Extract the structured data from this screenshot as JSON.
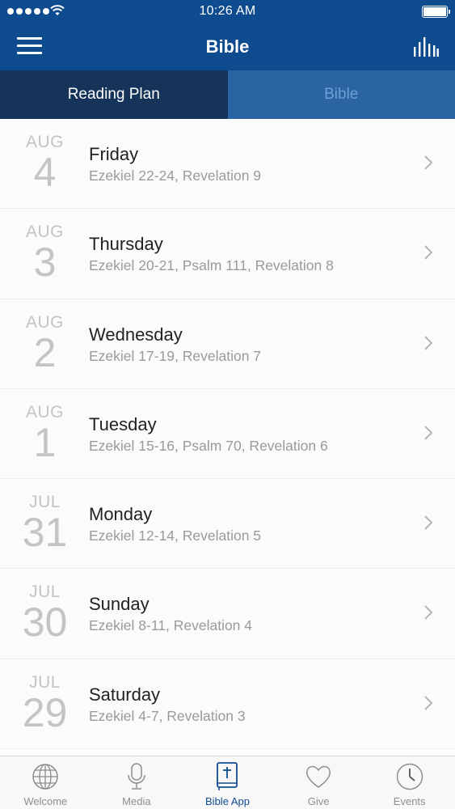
{
  "status_bar": {
    "time": "10:26 AM"
  },
  "nav": {
    "title": "Bible",
    "left_icon": "menu-icon",
    "right_icon": "audio-bars-icon"
  },
  "tabs": [
    {
      "label": "Reading Plan",
      "active": true
    },
    {
      "label": "Bible",
      "active": false
    }
  ],
  "readings": [
    {
      "month": "AUG",
      "day": "4",
      "weekday": "Friday",
      "passages": "Ezekiel 22-24, Revelation 9"
    },
    {
      "month": "AUG",
      "day": "3",
      "weekday": "Thursday",
      "passages": "Ezekiel 20-21, Psalm 111, Revelation 8"
    },
    {
      "month": "AUG",
      "day": "2",
      "weekday": "Wednesday",
      "passages": "Ezekiel 17-19, Revelation 7"
    },
    {
      "month": "AUG",
      "day": "1",
      "weekday": "Tuesday",
      "passages": "Ezekiel 15-16, Psalm 70, Revelation 6"
    },
    {
      "month": "JUL",
      "day": "31",
      "weekday": "Monday",
      "passages": "Ezekiel 12-14, Revelation 5"
    },
    {
      "month": "JUL",
      "day": "30",
      "weekday": "Sunday",
      "passages": "Ezekiel 8-11, Revelation 4"
    },
    {
      "month": "JUL",
      "day": "29",
      "weekday": "Saturday",
      "passages": "Ezekiel 4-7, Revelation 3"
    }
  ],
  "tabbar": [
    {
      "label": "Welcome",
      "icon": "globe-icon",
      "active": false
    },
    {
      "label": "Media",
      "icon": "microphone-icon",
      "active": false
    },
    {
      "label": "Bible App",
      "icon": "bible-icon",
      "active": true
    },
    {
      "label": "Give",
      "icon": "heart-icon",
      "active": false
    },
    {
      "label": "Events",
      "icon": "clock-icon",
      "active": false
    }
  ],
  "colors": {
    "header": "#0f4c8f",
    "tab_active": "#16345a",
    "tab_inactive": "#2a64a3",
    "accent": "#0f4c8f"
  }
}
